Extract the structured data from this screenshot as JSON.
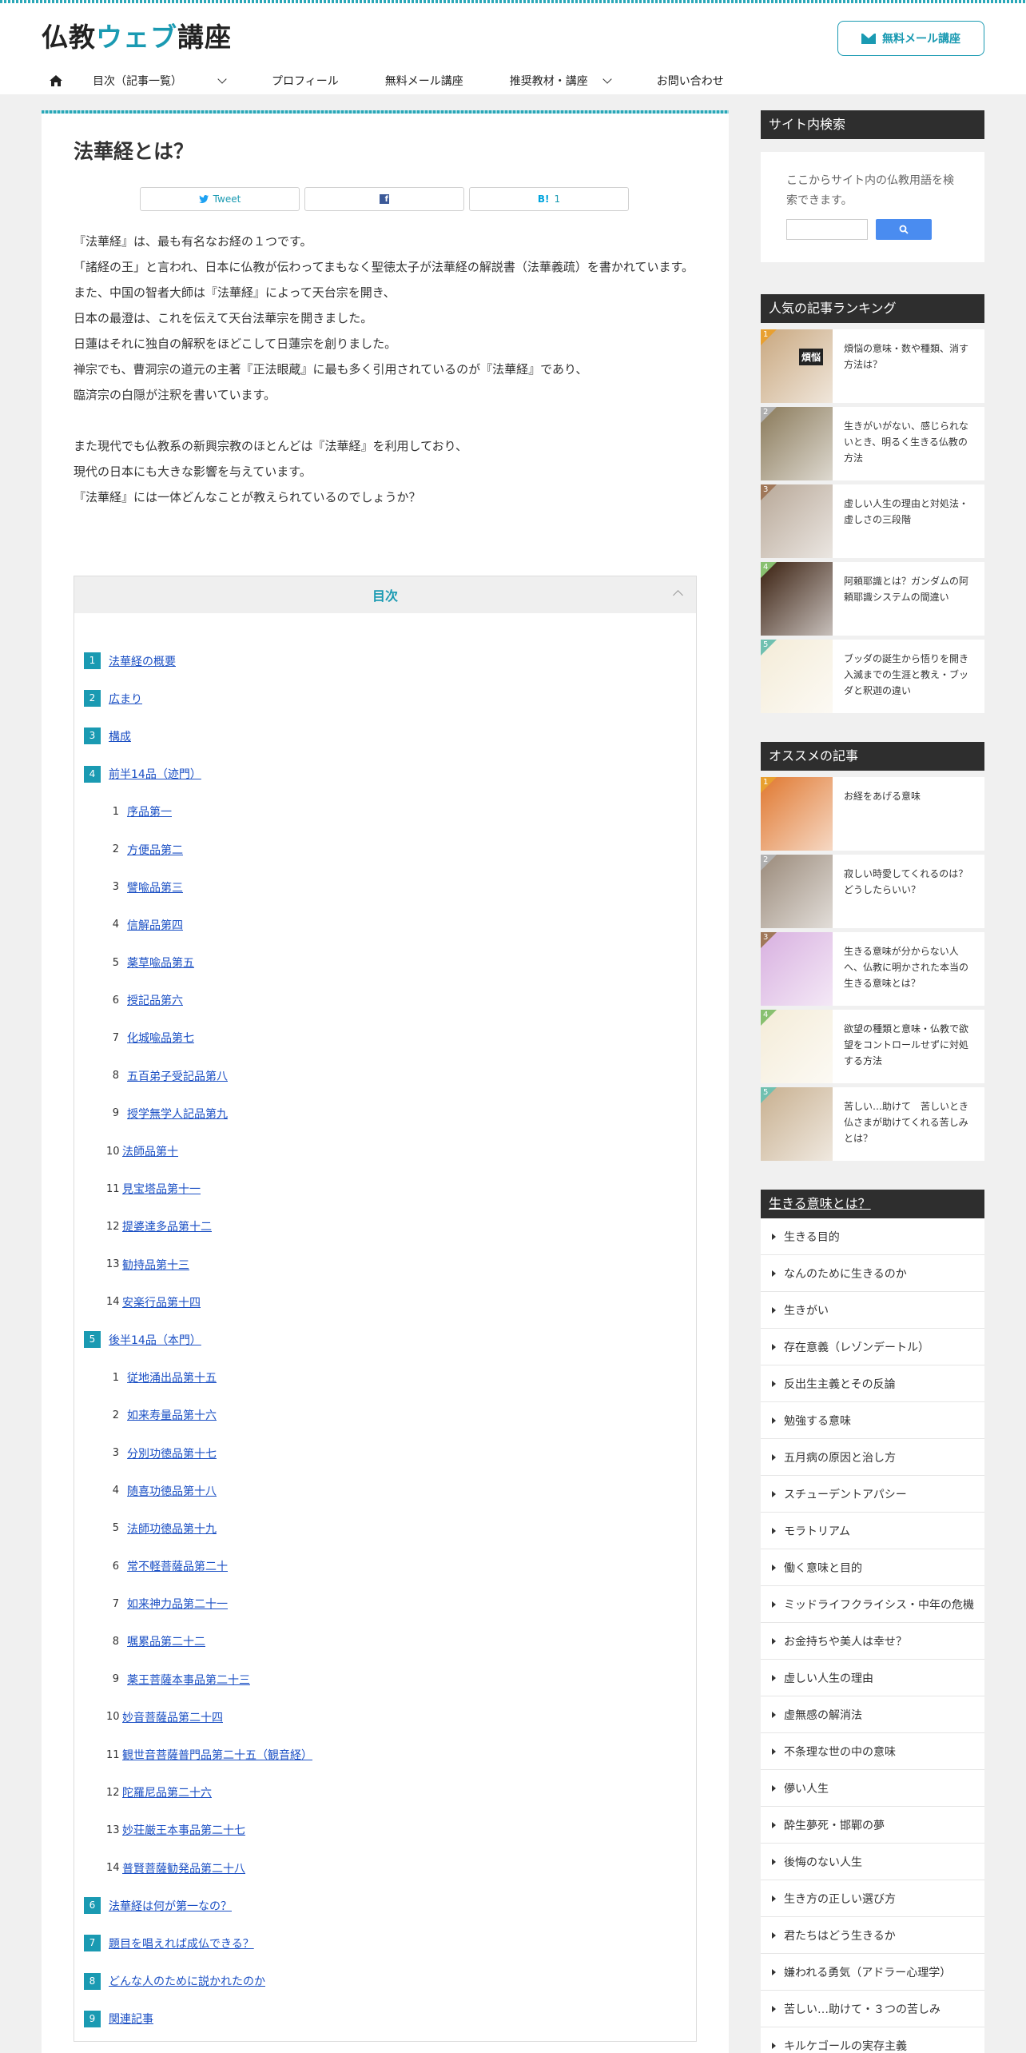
{
  "site": {
    "logo_part1": "仏教",
    "logo_part2": "ウェブ",
    "logo_part3": "講座",
    "mail_button": "無料メール講座"
  },
  "nav": [
    {
      "label": "目次（記事一覧）",
      "has_sub": true
    },
    {
      "label": "プロフィール",
      "has_sub": false
    },
    {
      "label": "無料メール講座",
      "has_sub": false
    },
    {
      "label": "推奨教材・講座",
      "has_sub": true
    },
    {
      "label": "お問い合わせ",
      "has_sub": false
    }
  ],
  "article": {
    "title": "法華経とは？",
    "share": {
      "tweet": "Tweet",
      "facebook": "f",
      "hatena": "B!",
      "hatena_count": "1"
    },
    "p1": "『法華経』は、最も有名なお経の１つです。",
    "p2": "「諸経の王」と言われ、日本に仏教が伝わってまもなく聖徳太子が法華経の解説書（法華義疏）を書かれています。",
    "p3": "また、中国の智者大師は『法華経』によって天台宗を開き、",
    "p4": "日本の最澄は、これを伝えて天台法華宗を開きました。",
    "p5": "日蓮はそれに独自の解釈をほどこして日蓮宗を創りました。",
    "p6": "禅宗でも、曹洞宗の道元の主著『正法眼蔵』に最も多く引用されているのが『法華経』であり、",
    "p7": "臨済宗の白隠が注釈を書いています。",
    "p8": "また現代でも仏教系の新興宗教のほとんどは『法華経』を利用しており、",
    "p9": "現代の日本にも大きな影響を与えています。",
    "p10": "『法華経』には一体どんなことが教えられているのでしょうか？"
  },
  "toc": {
    "title": "目次",
    "items": [
      {
        "num": "1",
        "label": "法華経の概要",
        "level": 1
      },
      {
        "num": "2",
        "label": "広まり",
        "level": 1
      },
      {
        "num": "3",
        "label": "構成",
        "level": 1
      },
      {
        "num": "4",
        "label": "前半14品（迹門）",
        "level": 1
      },
      {
        "num": "1",
        "label": "序品第一",
        "level": 2
      },
      {
        "num": "2",
        "label": "方便品第二",
        "level": 2
      },
      {
        "num": "3",
        "label": "譬喩品第三",
        "level": 2
      },
      {
        "num": "4",
        "label": "信解品第四",
        "level": 2
      },
      {
        "num": "5",
        "label": "薬草喩品第五",
        "level": 2
      },
      {
        "num": "6",
        "label": "授記品第六",
        "level": 2
      },
      {
        "num": "7",
        "label": "化城喩品第七",
        "level": 2
      },
      {
        "num": "8",
        "label": "五百弟子受記品第八",
        "level": 2
      },
      {
        "num": "9",
        "label": "授学無学人記品第九",
        "level": 2
      },
      {
        "num": "10",
        "label": "法師品第十",
        "level": 2
      },
      {
        "num": "11",
        "label": "見宝塔品第十一",
        "level": 2
      },
      {
        "num": "12",
        "label": "提婆達多品第十二",
        "level": 2
      },
      {
        "num": "13",
        "label": "勧持品第十三",
        "level": 2
      },
      {
        "num": "14",
        "label": "安楽行品第十四",
        "level": 2
      },
      {
        "num": "5",
        "label": "後半14品（本門）",
        "level": 1
      },
      {
        "num": "1",
        "label": "従地涌出品第十五",
        "level": 2
      },
      {
        "num": "2",
        "label": "如来寿量品第十六",
        "level": 2
      },
      {
        "num": "3",
        "label": "分別功徳品第十七",
        "level": 2
      },
      {
        "num": "4",
        "label": "随喜功徳品第十八",
        "level": 2
      },
      {
        "num": "5",
        "label": "法師功徳品第十九",
        "level": 2
      },
      {
        "num": "6",
        "label": "常不軽菩薩品第二十",
        "level": 2
      },
      {
        "num": "7",
        "label": "如来神力品第二十一",
        "level": 2
      },
      {
        "num": "8",
        "label": "嘱累品第二十二",
        "level": 2
      },
      {
        "num": "9",
        "label": "薬王菩薩本事品第二十三",
        "level": 2
      },
      {
        "num": "10",
        "label": "妙音菩薩品第二十四",
        "level": 2
      },
      {
        "num": "11",
        "label": "観世音菩薩普門品第二十五（観音経）",
        "level": 2
      },
      {
        "num": "12",
        "label": "陀羅尼品第二十六",
        "level": 2
      },
      {
        "num": "13",
        "label": "妙荘厳王本事品第二十七",
        "level": 2
      },
      {
        "num": "14",
        "label": "普賢菩薩勧発品第二十八",
        "level": 2
      },
      {
        "num": "6",
        "label": "法華経は何が第一なの？",
        "level": 1
      },
      {
        "num": "7",
        "label": "題目を唱えれば成仏できる？",
        "level": 1
      },
      {
        "num": "8",
        "label": "どんな人のために説かれたのか",
        "level": 1
      },
      {
        "num": "9",
        "label": "関連記事",
        "level": 1
      }
    ]
  },
  "sidebar": {
    "search": {
      "title": "サイト内検索",
      "desc": "ここからサイト内の仏教用語を検索できます。"
    },
    "ranking": {
      "title": "人気の記事ランキング",
      "items": [
        {
          "rank": "1",
          "text": "煩悩の意味・数や種類、消す方法は？",
          "color": "#e8a030",
          "thumb": "#c9a880",
          "thumb_text": "煩悩"
        },
        {
          "rank": "2",
          "text": "生きがいがない、感じられないとき、明るく生きる仏教の方法",
          "color": "#b0b0b0",
          "thumb": "#8a7a5a",
          "thumb_text": ""
        },
        {
          "rank": "3",
          "text": "虚しい人生の理由と対処法・虚しさの三段階",
          "color": "#a0785a",
          "thumb": "#b8a898",
          "thumb_text": ""
        },
        {
          "rank": "4",
          "text": "阿頼耶識とは？ガンダムの阿頼耶識システムの間違い",
          "color": "#88c070",
          "thumb": "#3a2010",
          "thumb_text": ""
        },
        {
          "rank": "5",
          "text": "ブッダの誕生から悟りを開き入滅までの生涯と教え・ブッダと釈迦の違い",
          "color": "#70c0b0",
          "thumb": "#f4ecd8",
          "thumb_text": ""
        }
      ]
    },
    "recommend": {
      "title": "オススメの記事",
      "items": [
        {
          "rank": "1",
          "text": "お経をあげる意味",
          "color": "#e8a030",
          "thumb": "#e07830"
        },
        {
          "rank": "2",
          "text": "寂しい時愛してくれるのは？どうしたらいい？",
          "color": "#b0b0b0",
          "thumb": "#9a8a7a"
        },
        {
          "rank": "3",
          "text": "生きる意味が分からない人へ、仏教に明かされた本当の生きる意味とは？",
          "color": "#a0785a",
          "thumb": "#d8b0e0"
        },
        {
          "rank": "4",
          "text": "欲望の種類と意味・仏教で欲望をコントロールせずに対処する方法",
          "color": "#88c070",
          "thumb": "#f4ecd8"
        },
        {
          "rank": "5",
          "text": "苦しい…助けて　苦しいとき仏さまが助けてくれる苦しみとは？",
          "color": "#70c0b0",
          "thumb": "#c8b090"
        }
      ]
    },
    "meaning": {
      "title": "生きる意味とは？",
      "items": [
        "生きる目的",
        "なんのために生きるのか",
        "生きがい",
        "存在意義（レゾンデートル）",
        "反出生主義とその反論",
        "勉強する意味",
        "五月病の原因と治し方",
        "スチューデントアパシー",
        "モラトリアム",
        "働く意味と目的",
        "ミッドライフクライシス・中年の危機",
        "お金持ちや美人は幸せ？",
        "虚しい人生の理由",
        "虚無感の解消法",
        "不条理な世の中の意味",
        "儚い人生",
        "酔生夢死・邯鄲の夢",
        "後悔のない人生",
        "生き方の正しい選び方",
        "君たちはどう生きるか",
        "嫌われる勇気（アドラー心理学）",
        "苦しい…助けて・３つの苦しみ",
        "キルケゴールの実存主義"
      ]
    }
  }
}
